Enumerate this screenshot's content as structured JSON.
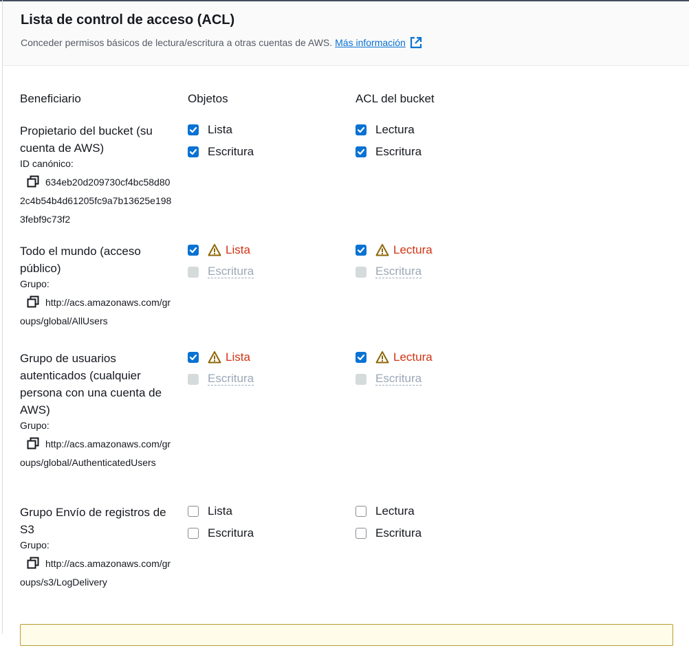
{
  "header": {
    "title": "Lista de control de acceso (ACL)",
    "description": "Conceder permisos básicos de lectura/escritura a otras cuentas de AWS.",
    "learn_more": "Más información"
  },
  "columns": {
    "grantee": "Beneficiario",
    "objects": "Objetos",
    "bucket_acl": "ACL del bucket"
  },
  "grantees": [
    {
      "name": "Propietario del bucket (su cuenta de AWS)",
      "kind": "ID canónico:",
      "id": "634eb20d209730cf4bc58d802c4b54b4d61205fc9a7b13625e1983febf9c73f2",
      "objects": [
        {
          "label": "Lista",
          "checked": true,
          "warning": false,
          "disabled": false
        },
        {
          "label": "Escritura",
          "checked": true,
          "warning": false,
          "disabled": false
        }
      ],
      "bucket_acl": [
        {
          "label": "Lectura",
          "checked": true,
          "warning": false,
          "disabled": false
        },
        {
          "label": "Escritura",
          "checked": true,
          "warning": false,
          "disabled": false
        }
      ]
    },
    {
      "name": "Todo el mundo (acceso público)",
      "kind": "Grupo:",
      "id": "http://acs.amazonaws.com/groups/global/AllUsers",
      "objects": [
        {
          "label": "Lista",
          "checked": true,
          "warning": true,
          "disabled": false
        },
        {
          "label": "Escritura",
          "checked": false,
          "warning": false,
          "disabled": true
        }
      ],
      "bucket_acl": [
        {
          "label": "Lectura",
          "checked": true,
          "warning": true,
          "disabled": false
        },
        {
          "label": "Escritura",
          "checked": false,
          "warning": false,
          "disabled": true
        }
      ]
    },
    {
      "name": "Grupo de usuarios autenticados (cualquier persona con una cuenta de AWS)",
      "kind": "Grupo:",
      "id": "http://acs.amazonaws.com/groups/global/AuthenticatedUsers",
      "objects": [
        {
          "label": "Lista",
          "checked": true,
          "warning": true,
          "disabled": false
        },
        {
          "label": "Escritura",
          "checked": false,
          "warning": false,
          "disabled": true
        }
      ],
      "bucket_acl": [
        {
          "label": "Lectura",
          "checked": true,
          "warning": true,
          "disabled": false
        },
        {
          "label": "Escritura",
          "checked": false,
          "warning": false,
          "disabled": true
        }
      ]
    },
    {
      "name": "Grupo Envío de registros de S3",
      "kind": "Grupo:",
      "id": "http://acs.amazonaws.com/groups/s3/LogDelivery",
      "objects": [
        {
          "label": "Lista",
          "checked": false,
          "warning": false,
          "disabled": false
        },
        {
          "label": "Escritura",
          "checked": false,
          "warning": false,
          "disabled": false
        }
      ],
      "bucket_acl": [
        {
          "label": "Lectura",
          "checked": false,
          "warning": false,
          "disabled": false
        },
        {
          "label": "Escritura",
          "checked": false,
          "warning": false,
          "disabled": false
        }
      ]
    }
  ],
  "colors": {
    "accent": "#0972d3",
    "warning_text": "#d13212",
    "warning_icon": "#8d6605",
    "disabled": "#9ba7b6"
  }
}
